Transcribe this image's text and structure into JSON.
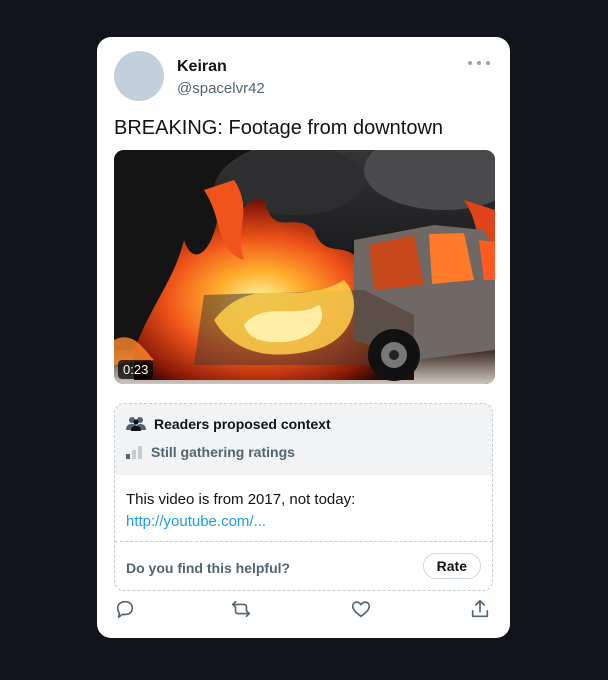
{
  "tweet": {
    "author_name": "Keiran",
    "author_handle": "@spacelvr42",
    "text": "BREAKING: Footage from downtown",
    "video_duration": "0:23"
  },
  "community_note": {
    "title": "Readers proposed context",
    "status": "Still gathering ratings",
    "body": "This video is from 2017, not today:",
    "link": "http://youtube.com/...",
    "prompt": "Do you find this helpful?",
    "rate_label": "Rate"
  },
  "actions": [
    "reply-icon",
    "retweet-icon",
    "like-icon",
    "share-icon"
  ],
  "colors": {
    "page_background": "#12141c",
    "card": "#ffffff",
    "link": "#1d9bf0",
    "secondary_text": "#536471"
  }
}
